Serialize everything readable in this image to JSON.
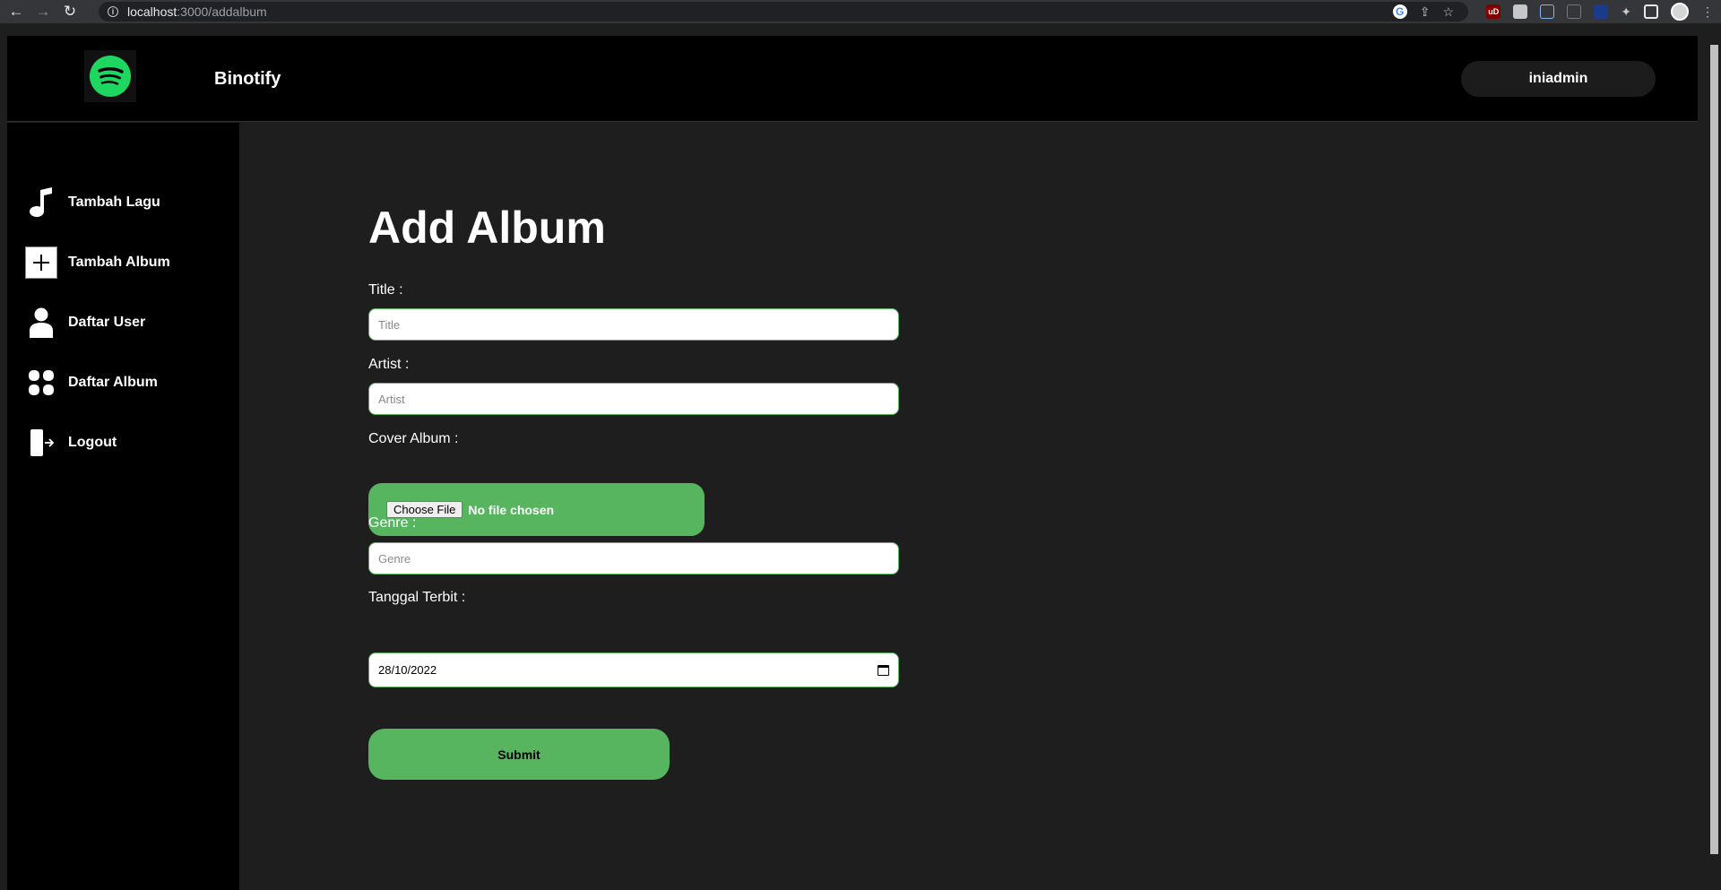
{
  "browser": {
    "url_host": "localhost",
    "url_path": ":3000/addalbum",
    "back_glyph": "←",
    "forward_glyph": "→",
    "reload_glyph": "↻",
    "info_glyph": "i",
    "google_glyph": "G",
    "share_glyph": "⇪",
    "star_glyph": "☆",
    "ublock_label": "uD",
    "puzzle_glyph": "✦",
    "menu_glyph": "⋮"
  },
  "header": {
    "brand": "Binotify",
    "user": "iniadmin"
  },
  "sidebar": {
    "items": [
      {
        "label": "Tambah Lagu",
        "icon": "music-note-icon"
      },
      {
        "label": "Tambah Album",
        "icon": "plus-square-icon"
      },
      {
        "label": "Daftar User",
        "icon": "user-icon"
      },
      {
        "label": "Daftar Album",
        "icon": "grid-icon"
      },
      {
        "label": "Logout",
        "icon": "logout-icon"
      }
    ]
  },
  "form": {
    "title": "Add Album",
    "title_label": "Title :",
    "title_placeholder": "Title",
    "artist_label": "Artist :",
    "artist_placeholder": "Artist",
    "cover_label": "Cover Album :",
    "choose_file": "Choose File",
    "file_status": "No file chosen",
    "genre_label": "Genre :",
    "genre_placeholder": "Genre",
    "date_label": "Tanggal Terbit :",
    "date_value": "28/10/2022",
    "submit": "Submit"
  },
  "colors": {
    "accent_green": "#57b560",
    "header_bg": "#000000",
    "main_bg": "#1e1e1e",
    "spotify_green": "#1ed760"
  }
}
